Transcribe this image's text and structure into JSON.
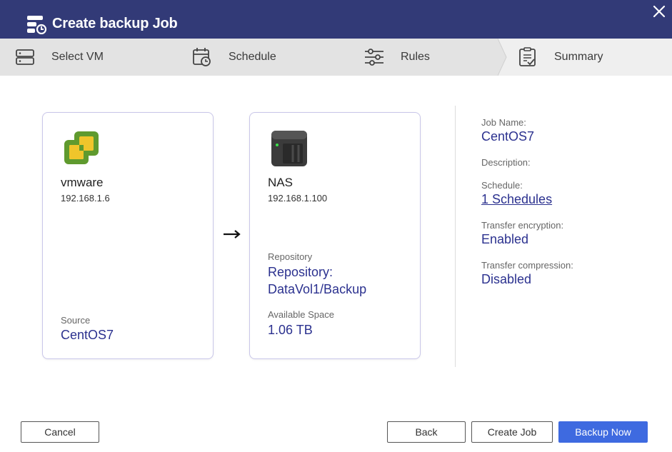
{
  "window": {
    "title": "Create backup Job",
    "close_icon": "close-icon",
    "header_color": "#323a77"
  },
  "steps": [
    {
      "label": "Select VM",
      "icon": "server-icon"
    },
    {
      "label": "Schedule",
      "icon": "calendar-clock-icon"
    },
    {
      "label": "Rules",
      "icon": "sliders-icon"
    },
    {
      "label": "Summary",
      "icon": "clipboard-check-icon",
      "active": true
    }
  ],
  "source_card": {
    "name": "vmware",
    "ip": "192.168.1.6",
    "source_label": "Source",
    "source_value": "CentOS7",
    "icon": "vmware-logo-icon"
  },
  "target_card": {
    "name": "NAS",
    "ip": "192.168.1.100",
    "repository_label": "Repository",
    "repository_line1": "Repository:",
    "repository_line2": "DataVol1/Backup",
    "space_label": "Available Space",
    "space_value": "1.06 TB",
    "icon": "nas-device-icon"
  },
  "summary": {
    "job_name_label": "Job Name:",
    "job_name_value": "CentOS7",
    "description_label": "Description:",
    "schedule_label": "Schedule:",
    "schedule_value": "1 Schedules",
    "encryption_label": "Transfer encryption:",
    "encryption_value": "Enabled",
    "compression_label": "Transfer compression:",
    "compression_value": "Disabled"
  },
  "buttons": {
    "cancel": "Cancel",
    "back": "Back",
    "create_job": "Create Job",
    "backup_now": "Backup Now"
  },
  "colors": {
    "accent": "#2b318f",
    "primary_button": "#3e6ae0",
    "card_border": "#c9c6e9"
  }
}
